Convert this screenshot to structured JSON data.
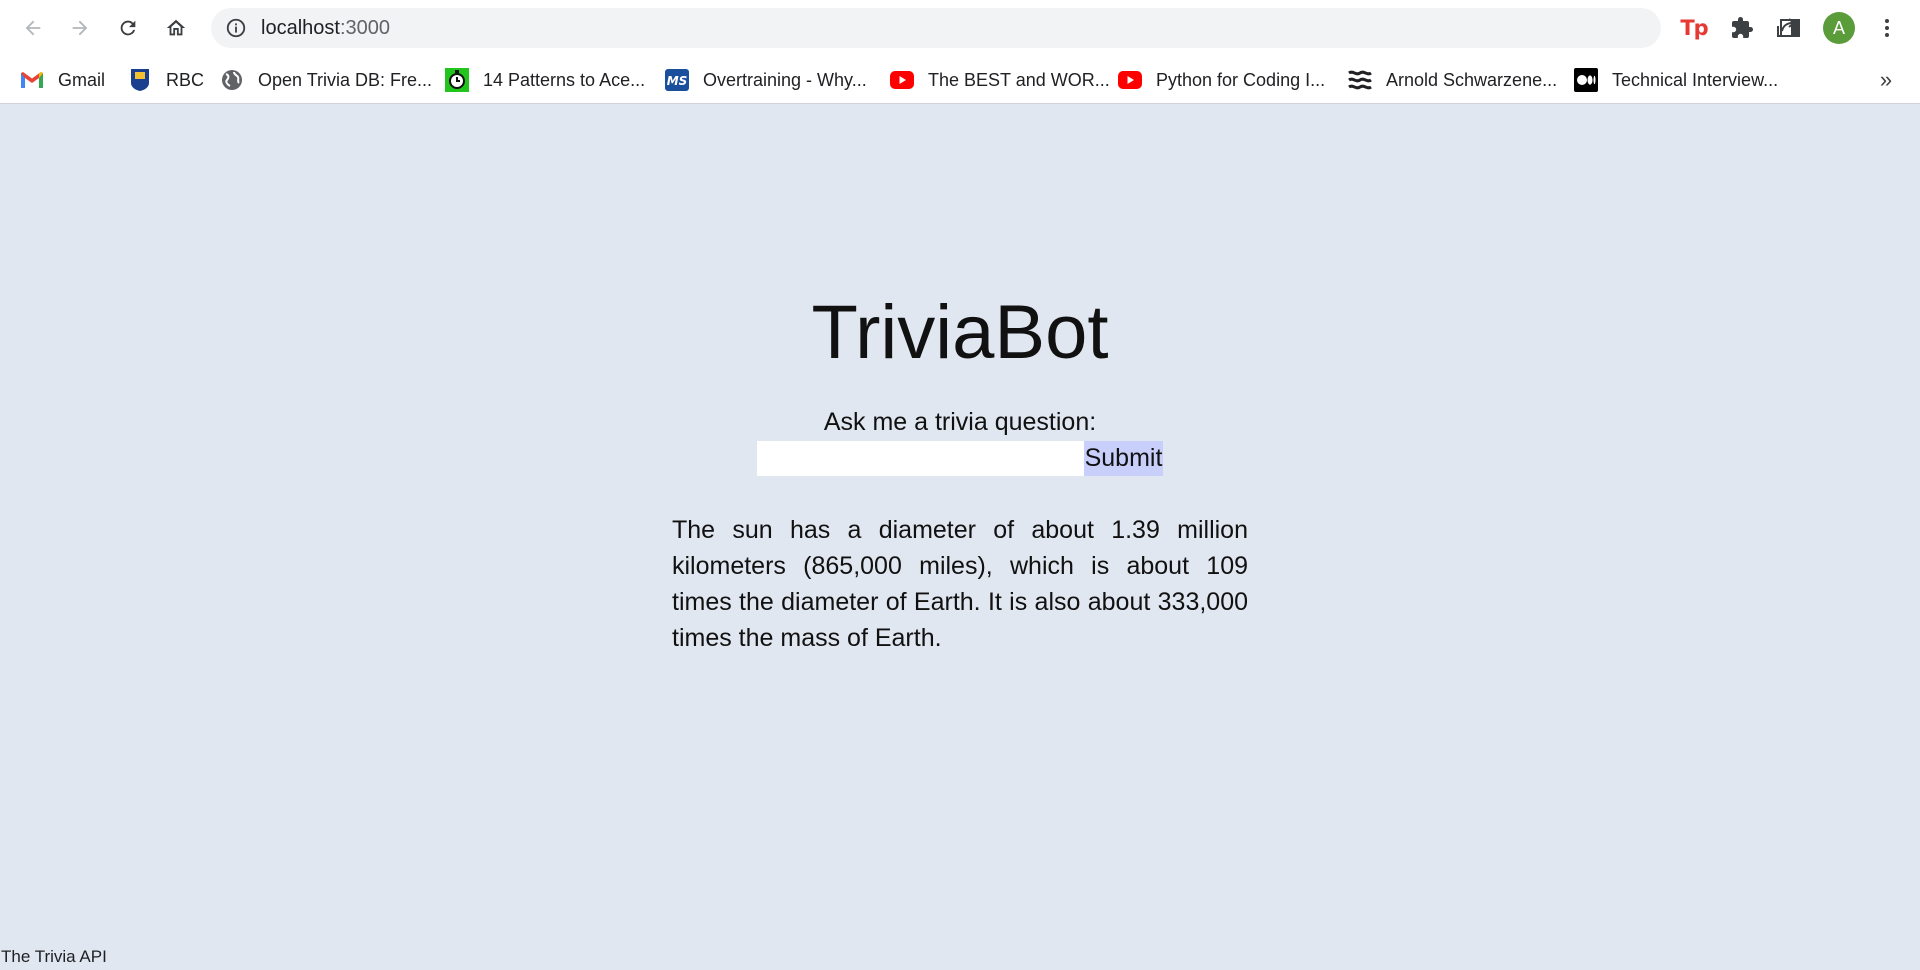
{
  "browser": {
    "url_host": "localhost",
    "url_port": ":3000",
    "profile_initial": "A",
    "extension_label": "Tp"
  },
  "bookmarks": [
    {
      "label": "Gmail",
      "icon": "gmail-icon"
    },
    {
      "label": "RBC",
      "icon": "rbc-icon"
    },
    {
      "label": "Open Trivia DB: Fre...",
      "icon": "globe-icon"
    },
    {
      "label": "14 Patterns to Ace...",
      "icon": "stopwatch-icon"
    },
    {
      "label": "Overtraining - Why...",
      "icon": "ms-icon"
    },
    {
      "label": "The BEST and WOR...",
      "icon": "youtube-icon"
    },
    {
      "label": "Python for Coding I...",
      "icon": "youtube-icon"
    },
    {
      "label": "Arnold Schwarzene...",
      "icon": "wave-icon"
    },
    {
      "label": "Technical Interview...",
      "icon": "medium-icon"
    }
  ],
  "page": {
    "title": "TriviaBot",
    "prompt_label": "Ask me a trivia question:",
    "input_value": "",
    "submit_label": "Submit",
    "answer": "The sun has a diameter of about 1.39 million kilometers (865,000 miles), which is about 109 times the diameter of Earth. It is also about 333,000 times the mass of Earth.",
    "footer": "The Trivia API"
  }
}
